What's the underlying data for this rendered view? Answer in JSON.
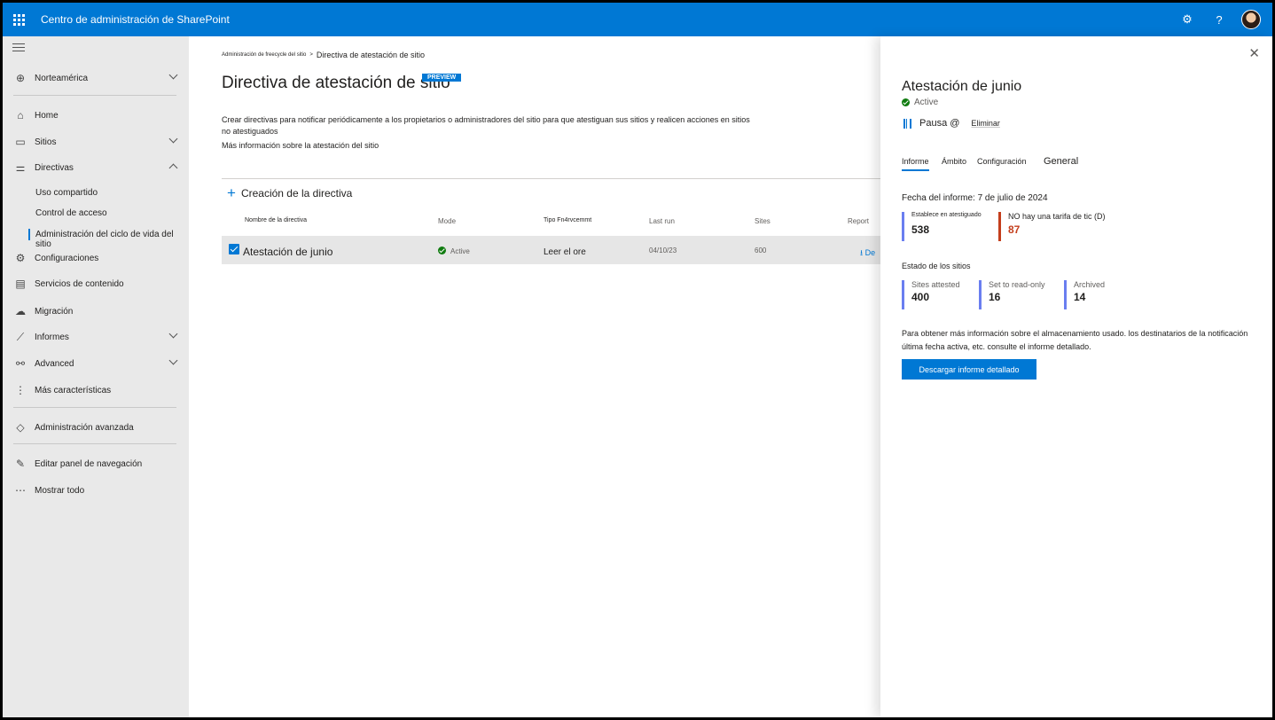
{
  "app": {
    "title": "Centro de administración de SharePoint"
  },
  "topbar": {
    "settings_icon": "gear-icon",
    "help_label": "?"
  },
  "nav": {
    "region": "Norteamérica",
    "items": {
      "home": "Home",
      "sitios": "Sitios",
      "directivas": "Directivas",
      "uso": "Uso compartido",
      "control": "Control de acceso",
      "ciclo": "Administración del ciclo de vida del sitio",
      "config": "Configuraciones",
      "servicios": "Servicios de contenido",
      "migracion": "Migración",
      "informes": "Informes",
      "advanced": "Advanced",
      "mas": "Más características",
      "avanzada": "Administración avanzada",
      "editar": "Editar panel de navegación",
      "mostrar": "Mostrar todo"
    }
  },
  "main": {
    "breadcrumb_parent": "Administración de freecycle del sitio",
    "breadcrumb_sep": "&gt;",
    "breadcrumb_current": "Directiva de atestación de sitio",
    "title": "Directiva de atestación de sitio",
    "badge": "PREVIEW",
    "description": "Crear directivas para notificar periódicamente a los propietarios o administradores del sitio para que atestiguan sus sitios y realicen acciones en sitios no atestiguados",
    "learn_more": "Más información sobre la atestación del sitio",
    "create_label": "Creación de la directiva",
    "columns": {
      "name": "Nombre de la directiva",
      "mode": "Mode",
      "tipo": "Tipo Fn4rvcemmt",
      "last_run": "Last run",
      "sites": "Sites",
      "report": "Report"
    },
    "rows": [
      {
        "name": "Atestación de junio",
        "mode": "Active",
        "tipo": "Leer el ore",
        "last_run": "04/10/23",
        "sites": "600",
        "report": "De"
      }
    ]
  },
  "panel": {
    "title": "Atestación de junio",
    "status": "Active",
    "pause": "Pausa @",
    "delete": "Eliminar",
    "tabs": {
      "informe": "Informe",
      "ambito": "Ámbito",
      "config": "Configuración",
      "general": "General"
    },
    "report_date": "Fecha del informe: 7 de julio de 2024",
    "stats": [
      {
        "label": "Establece en atestiguado",
        "value": "538"
      },
      {
        "label": "NO hay una tarifa de tic (D)",
        "value": "87",
        "color": "#c43e1c"
      }
    ],
    "site_status_title": "Estado de los sitios",
    "site_stats": [
      {
        "label": "Sites attested",
        "value": "400"
      },
      {
        "label": "Set to read-only",
        "value": "16"
      },
      {
        "label": "Archived",
        "value": "14"
      }
    ],
    "info": "Para obtener más información sobre el almacenamiento usado. los destinatarios de la notificación última fecha activa, etc. consulte el informe detallado.",
    "download": "Descargar informe detallado"
  },
  "colors": {
    "brand": "#0078d4",
    "success": "#107c10",
    "alert": "#c43e1c",
    "stat_bar": "#6a7ef0"
  }
}
